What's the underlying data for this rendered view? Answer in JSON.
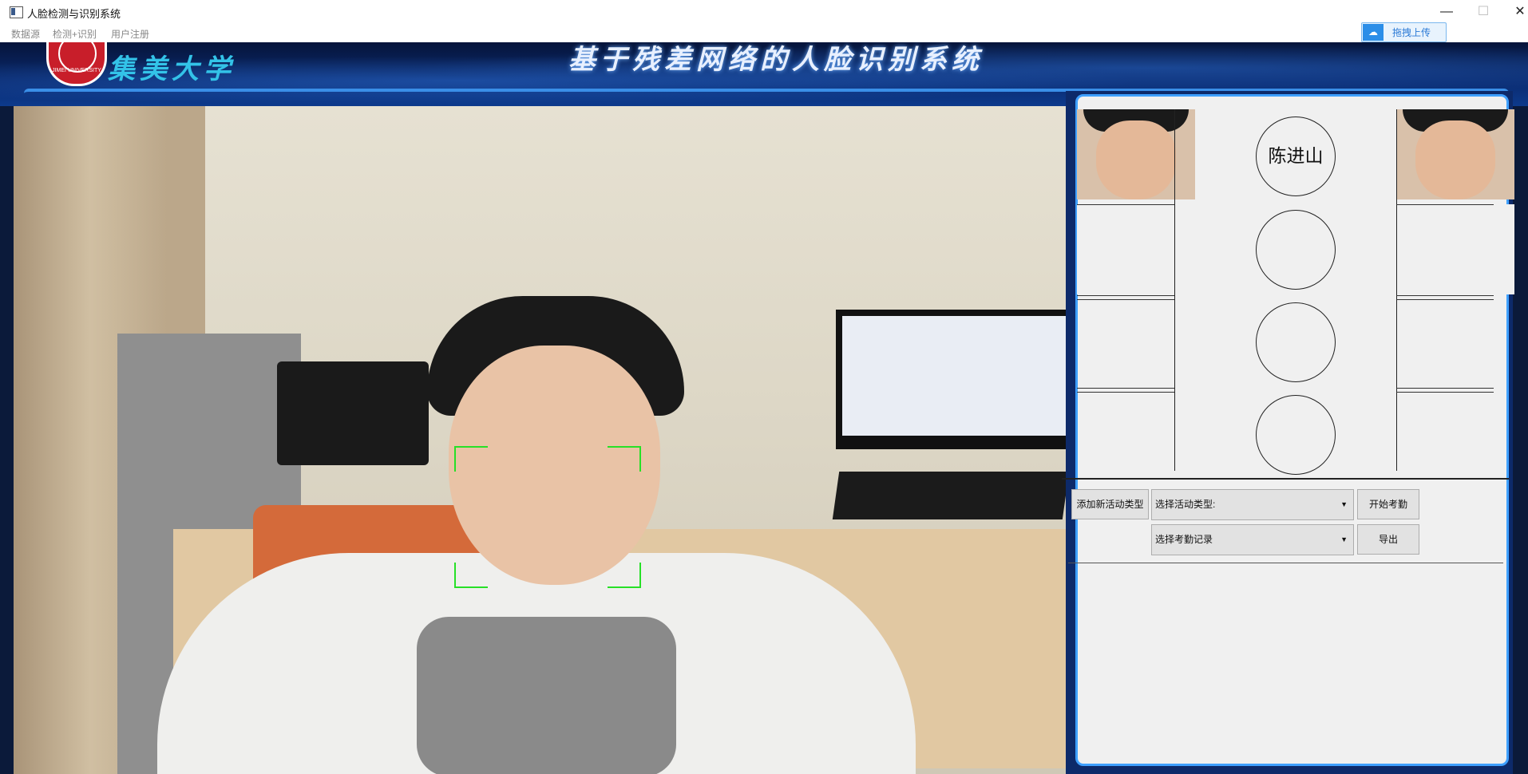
{
  "window": {
    "title": "人脸检测与识别系统",
    "minimize": "—",
    "maximize": "☐",
    "close": "✕"
  },
  "menu": {
    "items": [
      "数据源",
      "检测+识别",
      "用户注册"
    ]
  },
  "upload": {
    "label": "拖拽上传",
    "icon": "cloud-upload-icon"
  },
  "banner": {
    "school_name": "集美大学",
    "system_title": "基于残差网络的人脸识别系统",
    "logo_text": "JIMEI UNIVERSITY"
  },
  "camera": {
    "face_box_color": "#27e027"
  },
  "results": {
    "rows": [
      {
        "name": "陈进山",
        "has_faces": true
      },
      {
        "name": "",
        "has_faces": false
      },
      {
        "name": "",
        "has_faces": false
      },
      {
        "name": "",
        "has_faces": false
      }
    ]
  },
  "controls": {
    "add_activity_type": "添加新活动类型",
    "activity_type_select": "选择活动类型:",
    "start_attendance": "开始考勤",
    "attendance_record_select": "选择考勤记录",
    "export": "导出"
  },
  "colors": {
    "accent": "#3fa0ff",
    "upload": "#2b8ee8"
  }
}
